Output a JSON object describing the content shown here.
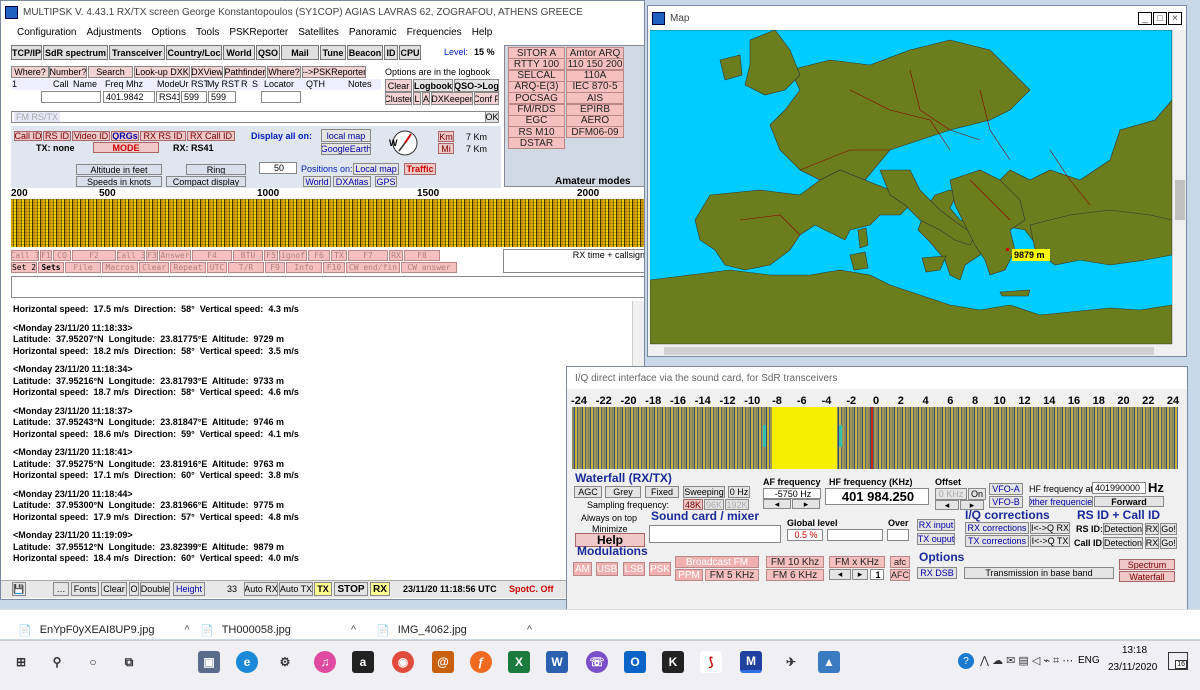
{
  "main_window": {
    "title": "MULTIPSK V. 4.43.1      RX/TX screen  George Konstantopoulos (SY1COP)    AGIAS LAVRAS 62,  ZOGRAFOU,  ATHENS    GREECE",
    "menu": [
      "Configuration",
      "Adjustments",
      "Options",
      "Tools",
      "PSKReporter",
      "Satellites",
      "Panoramic",
      "Frequencies",
      "Help"
    ],
    "tabs": [
      "TCP/IP",
      "SdR spectrum",
      "Transceiver",
      "Country/Loc",
      "World",
      "QSO",
      "Mail",
      "Tune",
      "Beacon",
      "ID",
      "CPU"
    ],
    "level_label": "Level:",
    "level_value": "15 %",
    "qso_buttons": [
      "Where?",
      "Number?",
      "Search",
      "Look-up DXK",
      "DXView",
      "Pathfinder",
      "Where?",
      "-->PSKReporter"
    ],
    "options_logbook": "Options are in the logbook",
    "qso_headers": [
      "Call",
      "Name",
      "Freq Mhz",
      "Mode",
      "Ur RST",
      "My RST",
      "R",
      "S",
      "Locator",
      "QTH",
      "Notes"
    ],
    "qso_num": "1",
    "qso_values": {
      "freq": "401.9842",
      "mode": "RS41",
      "ur_rst": "599",
      "my_rst": "599"
    },
    "log_buttons": {
      "clear": "Clear",
      "logbook": "Logbook",
      "qso_log": "QSO->Log",
      "cluster": "Cluster",
      "l": "L",
      "a": "A",
      "dxkeeper": "DXKeeper",
      "conf": "Conf F"
    },
    "rs_label": "FM RS/TX",
    "ok": "OK",
    "id_buttons": [
      "Call ID",
      "RS ID",
      "Video ID",
      "QRGs",
      "RX RS ID",
      "RX Call ID"
    ],
    "display_all": "Display all on:",
    "local_map": "local map",
    "google_earth": "GoogleEarth",
    "compass": "W",
    "tx_label": "TX: none",
    "mode_label": "MODE",
    "rx_label": "RX: RS41",
    "km_buttons": [
      "Km",
      "Mi"
    ],
    "km_values": [
      "7 Km",
      "7 Km"
    ],
    "altitude": "Altitude in feet",
    "speeds": "Speeds in knots",
    "ring": "Ring",
    "ring_value": "50",
    "compact": "Compact display",
    "positions_on": "Positions on:",
    "pos_local_map": "Local map",
    "pos_traffic": "Traffic",
    "world": "World",
    "dxatlas": "DXAtlas",
    "gps": "GPS",
    "modes_grid": [
      [
        "SITOR A",
        "Amtor ARQ"
      ],
      [
        "RTTY 100",
        "110 150 200"
      ],
      [
        "SELCAL",
        "110A"
      ],
      [
        "ARQ-E(3)",
        "IEC 870-5"
      ],
      [
        "POCSAG",
        "AIS"
      ],
      [
        "FM/RDS",
        "EPIRB"
      ],
      [
        "EGC",
        "AERO"
      ],
      [
        "RS M10",
        "DFM06-09"
      ],
      [
        "DSTAR",
        ""
      ]
    ],
    "amateur_modes": "Amateur modes",
    "scale": [
      "200",
      "500",
      "1000",
      "1500",
      "2000"
    ],
    "macro_row1": [
      "Call 1",
      "F1",
      "CQ",
      "F2",
      "Call 3",
      "F3",
      "Answer",
      "F4",
      "BTU",
      "F5",
      "Signoff",
      "F6",
      "TX",
      "F7",
      "RX",
      "F8"
    ],
    "macro_row2": [
      "Set 2",
      "Sets",
      "File",
      "Macros",
      "Clear",
      "Repeat",
      "UTC",
      "T/R",
      "F9",
      "Info",
      "F10",
      "CW end/fin",
      "CW answer"
    ],
    "rx_time": "RX time + callsign",
    "log_entries": [
      {
        "time": "",
        "lat": "",
        "lon": "",
        "alt": "",
        "hspeed": "17.5 m/s",
        "dir": "58°",
        "vspeed": "4.3 m/s"
      },
      {
        "time": "<Monday 23/11/20 11:18:33>",
        "lat": "37.95207°N",
        "lon": "23.81775°E",
        "alt": "9729 m",
        "hspeed": "18.2 m/s",
        "dir": "58°",
        "vspeed": "3.5 m/s"
      },
      {
        "time": "<Monday 23/11/20 11:18:34>",
        "lat": "37.95216°N",
        "lon": "23.81793°E",
        "alt": "9733 m",
        "hspeed": "18.7 m/s",
        "dir": "58°",
        "vspeed": "4.6 m/s"
      },
      {
        "time": "<Monday 23/11/20 11:18:37>",
        "lat": "37.95243°N",
        "lon": "23.81847°E",
        "alt": "9746 m",
        "hspeed": "18.6 m/s",
        "dir": "59°",
        "vspeed": "4.1 m/s"
      },
      {
        "time": "<Monday 23/11/20 11:18:41>",
        "lat": "37.95275°N",
        "lon": "23.81916°E",
        "alt": "9763 m",
        "hspeed": "17.1 m/s",
        "dir": "60°",
        "vspeed": "3.8 m/s"
      },
      {
        "time": "<Monday 23/11/20 11:18:44>",
        "lat": "37.95300°N",
        "lon": "23.81966°E",
        "alt": "9775 m",
        "hspeed": "17.9 m/s",
        "dir": "57°",
        "vspeed": "4.8 m/s"
      },
      {
        "time": "<Monday 23/11/20 11:19:09>",
        "lat": "37.95512°N",
        "lon": "23.82399°E",
        "alt": "9879 m",
        "hspeed": "18.4 m/s",
        "dir": "60°",
        "vspeed": "4.0 m/s"
      }
    ],
    "log_words": {
      "lat": "Latitude:",
      "lon": "Longitude:",
      "alt": "Altitude:",
      "hs": "Horizontal speed:",
      "dir": "Direction:",
      "vs": "Vertical speed:"
    },
    "bottom": {
      "fonts": "Fonts",
      "clear": "Clear",
      "o": "O",
      "double": "Double",
      "height": "Height",
      "size": "33",
      "auto_rx": "Auto RX",
      "auto_tx": "Auto TX",
      "tx": "TX",
      "stop": "STOP",
      "rx": "RX",
      "utc": "23/11/20  11:18:56 UTC",
      "spotc": "SpotC. Off"
    }
  },
  "map_window": {
    "title": "Map",
    "balloon_alt": "9879 m"
  },
  "iq_window": {
    "title": "I/Q direct interface via the sound card, for SdR transceivers",
    "ticks": [
      "-24",
      "-22",
      "-20",
      "-18",
      "-16",
      "-14",
      "-12",
      "-10",
      "-8",
      "-6",
      "-4",
      "-2",
      "0",
      "2",
      "4",
      "6",
      "8",
      "10",
      "12",
      "14",
      "16",
      "18",
      "20",
      "22",
      "24"
    ],
    "waterfall_label": "Waterfall (RX/TX)",
    "agc": "AGC",
    "grey": "Grey",
    "fixed": "Fixed",
    "sweeping": "Sweeping",
    "zero_hz": "0 Hz",
    "sampling": "Sampling frequency:",
    "rates": [
      "48K",
      "96K",
      "192K"
    ],
    "af_label": "AF frequency",
    "af_value": "-5750 Hz",
    "hf_label": "HF frequency (KHz)",
    "hf_value": "401 984.250",
    "offset_label": "Offset",
    "offset_value": "0 KHz",
    "on": "On",
    "vfo_a": "VFO-A",
    "vfo_b": "VFO-B",
    "hf_at_zero": "HF frequency at 0",
    "hf_zero_value": "401990000",
    "hz": "Hz",
    "other_freq": "Other frequencies",
    "forward": "Forward",
    "always_on_top": "Always on top",
    "minimize": "Minimize",
    "help": "Help",
    "sound_card": "Sound card / mixer",
    "global_level": "Global level",
    "global_value": "0.5 %",
    "over": "Over",
    "rx_input": "RX input",
    "tx_ouput": "TX ouput",
    "iq_corr": "I/Q corrections",
    "rx_corr": "RX corrections",
    "tx_corr": "TX corrections",
    "iq_rx": "I<->Q RX",
    "iq_tx": "I<->Q TX",
    "rs_id_call": "RS ID + Call ID",
    "rs_id": "RS ID:",
    "call_id": "Call ID:",
    "detection": "Detection",
    "rx": "RX",
    "go": "Go!",
    "modulations": "Modulations",
    "mods": [
      "AM",
      "USB",
      "LSB",
      "PSK"
    ],
    "broadcast": "Broadcast FM",
    "ppm": "PPM",
    "fm5": "FM 5 KHz",
    "fm10": "FM 10 Khz",
    "fm6": "FM 6 KHz",
    "fmx": "FM x KHz",
    "afc": "afc",
    "afc2": "AFC",
    "one": "1",
    "options": "Options",
    "rx_dsb": "RX DSB",
    "baseband": "Transmission in base band",
    "spectrum": "Spectrum",
    "waterfall": "Waterfall"
  },
  "taskbar": {
    "files": [
      "EnYpF0yXEAI8UP9.jpg",
      "TH000058.jpg",
      "IMG_4062.jpg"
    ],
    "lang": "ENG",
    "time": "13:18",
    "date": "23/11/2020",
    "badge": "16"
  }
}
